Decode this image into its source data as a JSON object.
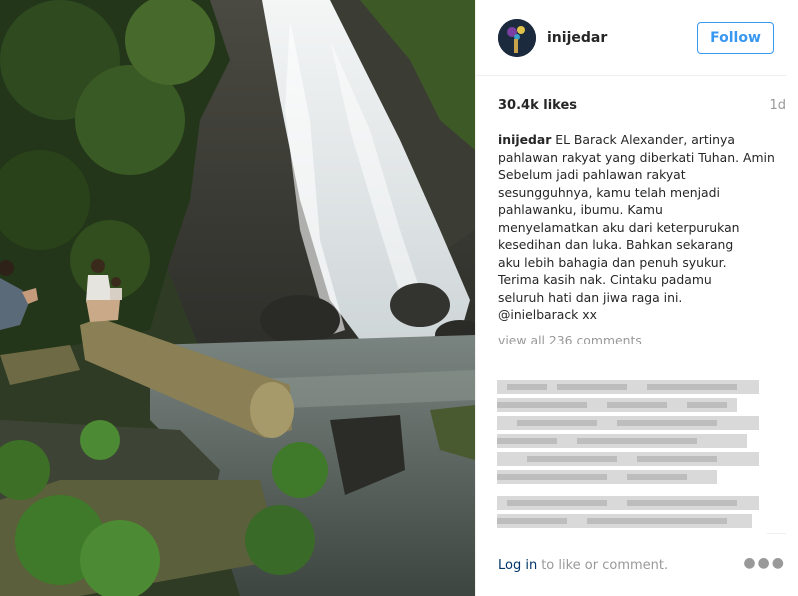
{
  "post": {
    "username": "inijedar",
    "follow_label": "Follow",
    "likes": "30.4k likes",
    "age": "1d",
    "caption_user": "inijedar",
    "caption_text": " EL Barack Alexander, artinya pahlawan rakyat yang diberkati Tuhan. Amin",
    "caption_lines": [
      "Sebelum jadi pahlawan rakyat",
      "sesungguhnya, kamu telah menjadi",
      "pahlawanku, ibumu. Kamu",
      "menyelamatkan aku dari keterpurukan",
      "kesedihan dan luka. Bahkan sekarang",
      "aku lebih bahagia dan penuh syukur.",
      "Terima kasih nak. Cintaku padamu",
      "seluruh hati dan jiwa raga ini."
    ],
    "mention": "@inielbarack xx",
    "view_all": "view all 236 comments",
    "login_link": "Log in",
    "login_suffix": "to like or comment.",
    "more_icon": "ellipsis-icon"
  }
}
